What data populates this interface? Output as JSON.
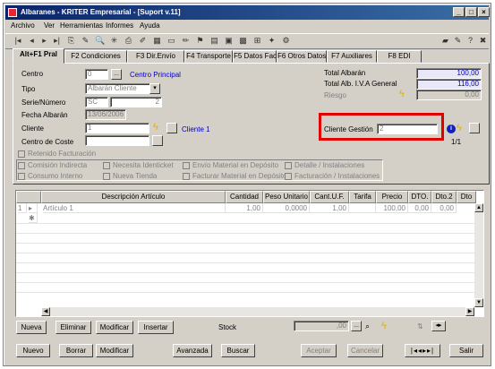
{
  "window": {
    "title": "Albaranes - KRITER Empresarial - [Suport v.11]",
    "min": "_",
    "max": "□",
    "close": "×"
  },
  "menu": [
    "Archivo",
    "Ver",
    "Herramientas",
    "Informes",
    "Ayuda"
  ],
  "tabs": [
    "Alt+F1 Pral",
    "F2 Condiciones",
    "F3 Dir.Envío",
    "F4 Transporte",
    "F5 Datos Fac",
    "F6 Otros Datos",
    "F7 Auxiliares",
    "F8 EDI"
  ],
  "form": {
    "centro_label": "Centro",
    "centro_value": "0",
    "centro_link": "Centro Principal",
    "tipo_label": "Tipo",
    "tipo_value": "Albarán Cliente",
    "serie_label": "Serie/Número",
    "serie_value": "SC",
    "numero_value": "2",
    "fecha_label": "Fecha Albarán",
    "fecha_value": "13/06/2006",
    "cliente_label": "Cliente",
    "cliente_value": "1",
    "cliente_link": "Cliente 1",
    "coste_label": "Centro de Coste",
    "coste_value": "",
    "total_albaran_label": "Total Albarán",
    "total_albaran_value": "100,00",
    "total_iva_label": "Total Alb. I.V.A General",
    "total_iva_value": "116,00",
    "riesgo_label": "Riesgo",
    "riesgo_value": "0,00",
    "cliente_gestion_label": "Cliente Gestión",
    "cliente_gestion_value": "2",
    "pager": "1/1"
  },
  "checkboxes": [
    "Retenido Facturación",
    "Comisión Indirecta",
    "Necesita Identicket",
    "Envío Material en Depósito",
    "Detalle / Instalaciones",
    "Consumo Interno",
    "Nueva Tienda",
    "Facturar Material en Depósito",
    "Facturación / Instalaciones"
  ],
  "grid": {
    "headers": [
      "Descripción Artículo",
      "Cantidad",
      "Peso Unitario",
      "Cant.U.F.",
      "Tarifa",
      "Precio",
      "DTO.",
      "Dto.2",
      "Dto"
    ],
    "row1": {
      "num": "1",
      "desc": "Artículo 1",
      "cantidad": "1,00",
      "peso": "0,0000",
      "cantuf": "1,00",
      "tarifa": "",
      "precio": "100,00",
      "dto": "0,00",
      "dto2": "0,00"
    }
  },
  "line_buttons": [
    "Nueva",
    "Eliminar",
    "Modificar",
    "Insertar"
  ],
  "stock_label": "Stock",
  "stock_value": ",00",
  "bottom_buttons": [
    "Nuevo",
    "Borrar",
    "Modificar",
    "Avanzada",
    "Buscar",
    "Aceptar",
    "Cancelar",
    "Salir"
  ],
  "colors": {
    "title_start": "#0a246a",
    "title_end": "#3a6ea5",
    "highlight": "#e00000",
    "link": "#0000c0"
  }
}
